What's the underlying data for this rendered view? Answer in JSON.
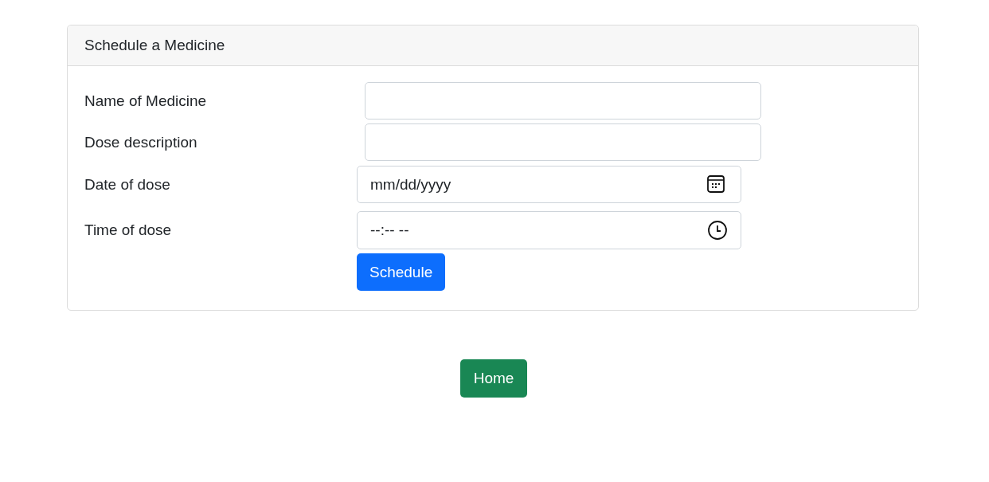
{
  "card": {
    "title": "Schedule a Medicine"
  },
  "fields": [
    {
      "kind": "text",
      "label": "Name of Medicine"
    },
    {
      "kind": "text",
      "label": "Dose description"
    },
    {
      "kind": "date",
      "label": "Date of dose",
      "placeholder": "mm/dd/yyyy"
    },
    {
      "kind": "time",
      "label": "Time of dose",
      "placeholder": "--:-- --"
    }
  ],
  "submit_button": "Schedule",
  "home_button": "Home"
}
